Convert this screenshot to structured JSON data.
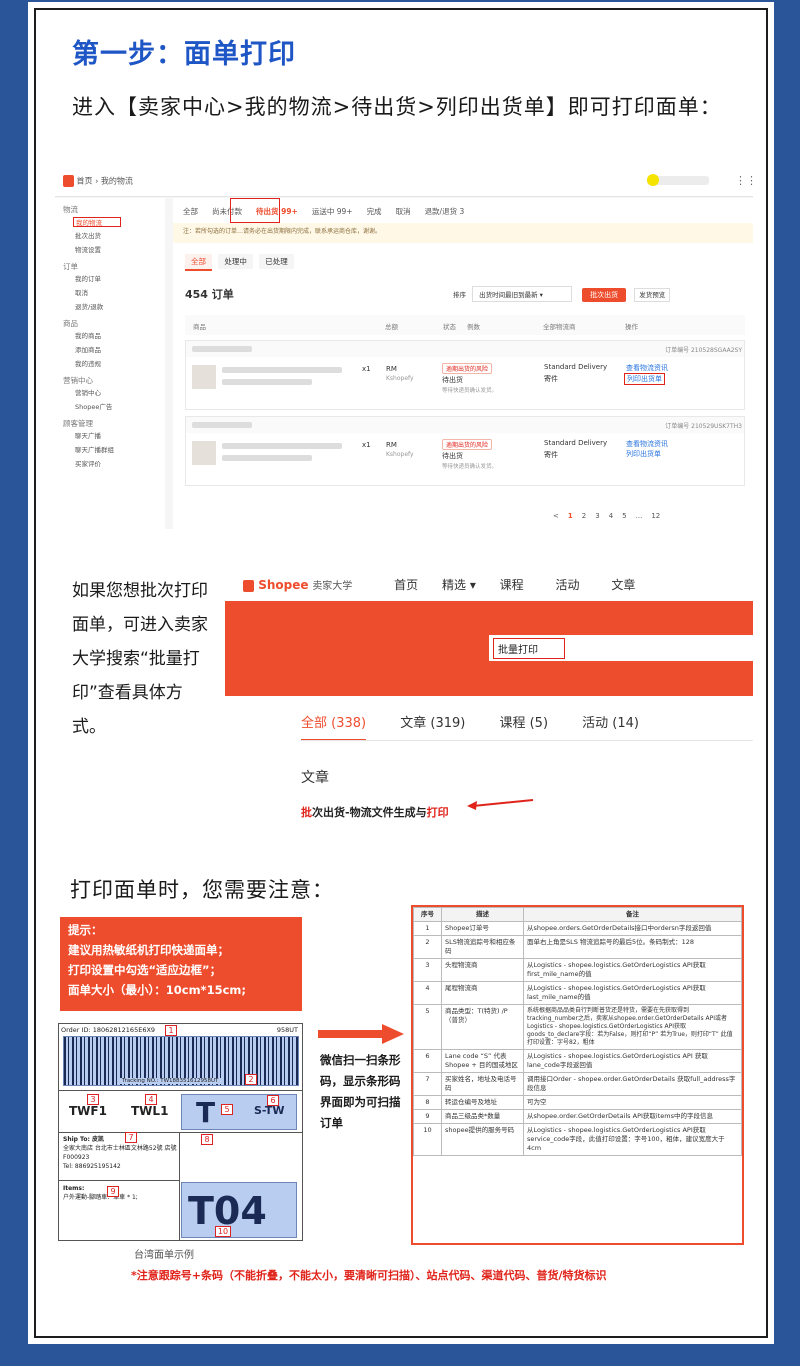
{
  "step_title": "第一步：面单打印",
  "intro": "进入【卖家中心>我的物流>待出货>列印出货单】即可打印面单：",
  "seller": {
    "breadcrumb_home": "首页",
    "breadcrumb_current": "我的物流",
    "sidebar": [
      {
        "head": "物流",
        "items": [
          "我的物流",
          "批次出货",
          "物流设置"
        ]
      },
      {
        "head": "订单",
        "items": [
          "我的订单",
          "取消",
          "退货/退款"
        ]
      },
      {
        "head": "商品",
        "items": [
          "我的商品",
          "添加商品",
          "我的违规"
        ]
      },
      {
        "head": "营销中心",
        "items": [
          "营销中心",
          "Shopee广告"
        ]
      },
      {
        "head": "顾客管理",
        "items": [
          "聊天广播",
          "聊天广播群组",
          "买家评价"
        ]
      }
    ],
    "tabs": [
      "全部",
      "尚未付款",
      "待出货 99+",
      "运送中 99+",
      "完成",
      "取消",
      "退款/退货 3"
    ],
    "notice": "注：若所勾选的订单…请务必在出货期限内完成，联系承运商仓库，谢谢。",
    "subtabs": [
      "全部",
      "处理中",
      "已处理"
    ],
    "order_count": "454 订单",
    "sort_label": "排序",
    "sort_value": "出货时间最旧到最新",
    "batch_btn": "批次出货",
    "ship_btn": "发货预览",
    "columns": [
      "商品",
      "总额",
      "状态",
      "例数",
      "全部物流商",
      "操作"
    ],
    "orders": [
      {
        "no": "订单编号 210528SGAA2SY",
        "qty": "x1",
        "price": "RM",
        "pay": "Kshopefy",
        "risk": "逾期出货的风险",
        "status": "待出货",
        "sub": "等待快递员确认发货。",
        "logistics": "Standard Delivery",
        "type": "寄件",
        "act1": "查看物流资讯",
        "act2": "列印出货单"
      },
      {
        "no": "订单编号 210529USK7TH3",
        "qty": "x1",
        "price": "RM",
        "pay": "Kshopefy",
        "risk": "逾期出货的风险",
        "status": "待出货",
        "sub": "等待快递员确认发货。",
        "logistics": "Standard Delivery",
        "type": "寄件",
        "act1": "查看物流资讯",
        "act2": "列印出货单"
      }
    ],
    "pages": [
      "<",
      "1",
      "2",
      "3",
      "4",
      "5",
      "...",
      "12"
    ]
  },
  "uni_note": "如果您想批次打印面单，可进入卖家大学搜索“批量打印”查看具体方式。",
  "uni": {
    "logo": "Shopee",
    "logo_sub": "卖家大学",
    "nav": [
      "首页",
      "精选",
      "课程",
      "活动",
      "文章"
    ],
    "search": "批量打印",
    "tabs": [
      "全部 (338)",
      "文章 (319)",
      "课程 (5)",
      "活动 (14)"
    ],
    "section": "文章",
    "result_hl1": "批",
    "result_mid": "次出货-物流文件生成与",
    "result_hl2": "打印"
  },
  "notes_title": "打印面单时，您需要注意：",
  "tip": [
    "提示：",
    "建议用热敏纸机打印快递面单；",
    "打印设置中勾选“适应边框”；",
    "面单大小（最小）：10cm*15cm;"
  ],
  "label": {
    "order_id": "Order ID: 18062812165E6X9",
    "code": "958UT",
    "tracking": "Tracking NO.: TW188351612958UT",
    "twf": "TWF1",
    "twl": "TWL1",
    "t": "T",
    "stw": "S-TW",
    "ship_to": "Ship To: 皮凯",
    "addr": "全家大南店 台北市士林區文林路52號 店號",
    "addr2": "F000923",
    "tel": "Tel: 886925195142",
    "items": "Items:",
    "item1": "户外運動-腳踏車：車車 * 1;",
    "big": "T04",
    "caption": "台湾面单示例",
    "nums": [
      "1",
      "2",
      "3",
      "4",
      "5",
      "6",
      "7",
      "8",
      "9",
      "10"
    ]
  },
  "scan_note": "微信扫一扫条形码，显示条形码界面即为可扫描订单",
  "table": {
    "headers": [
      "序号",
      "描述",
      "备注"
    ],
    "rows": [
      [
        "1",
        "Shopee订单号",
        "从shopee.orders.GetOrderDetails接口中ordersn字段返回值"
      ],
      [
        "2",
        "SLS物流追踪号和相应条码",
        "面单右上角是SLS 物流追踪号的最后5位。条码制式：128"
      ],
      [
        "3",
        "头程物流商",
        "从Logistics - shopee.logistics.GetOrderLogistics API获取first_mile_name的值"
      ],
      [
        "4",
        "尾程物流商",
        "从Logistics - shopee.logistics.GetOrderLogistics API获取last_mile_name的值"
      ],
      [
        "5",
        "商品类型：T(特货) /P（普货）",
        "系统根据商品品类自行判断普货还是特货，需要在先获取得到tracking_number之后，卖家从shopee.order.GetOrderDetails API或者Logistics - shopee.logistics.GetOrderLogistics API获取goods_to_declare字段：若为False，则打印“P” 若为True，则打印“T” 此值打印设置：字号82，粗体"
      ],
      [
        "6",
        "Lane code “S” 代表Shopee + 目的国或地区",
        "从Logistics - shopee.logistics.GetOrderLogistics API 获取lane_code字段返回值"
      ],
      [
        "7",
        "买家姓名，地址及电话号码",
        "调用接口Order - shopee.order.GetOrderDetails 获取full_address字段信息"
      ],
      [
        "8",
        "转运仓编号及地址",
        "可为空"
      ],
      [
        "9",
        "商品三级品类*数量",
        "从shopee.order.GetOrderDetails API获取items中的字段信息"
      ],
      [
        "10",
        "shopee提供的服务号码",
        "从Logistics - shopee.logistics.GetOrderLogistics API获取service_code字段，此值打印设置：字号100，粗体，建议宽度大于4cm"
      ]
    ]
  },
  "footnote": "*注意跟踪号+条码（不能折叠，不能太小，要清晰可扫描）、站点代码、渠道代码、普货/特货标识",
  "colors": {
    "brand": "#ee4d2d",
    "title_blue": "#1f56c6",
    "bg_blue": "#2a5599"
  }
}
